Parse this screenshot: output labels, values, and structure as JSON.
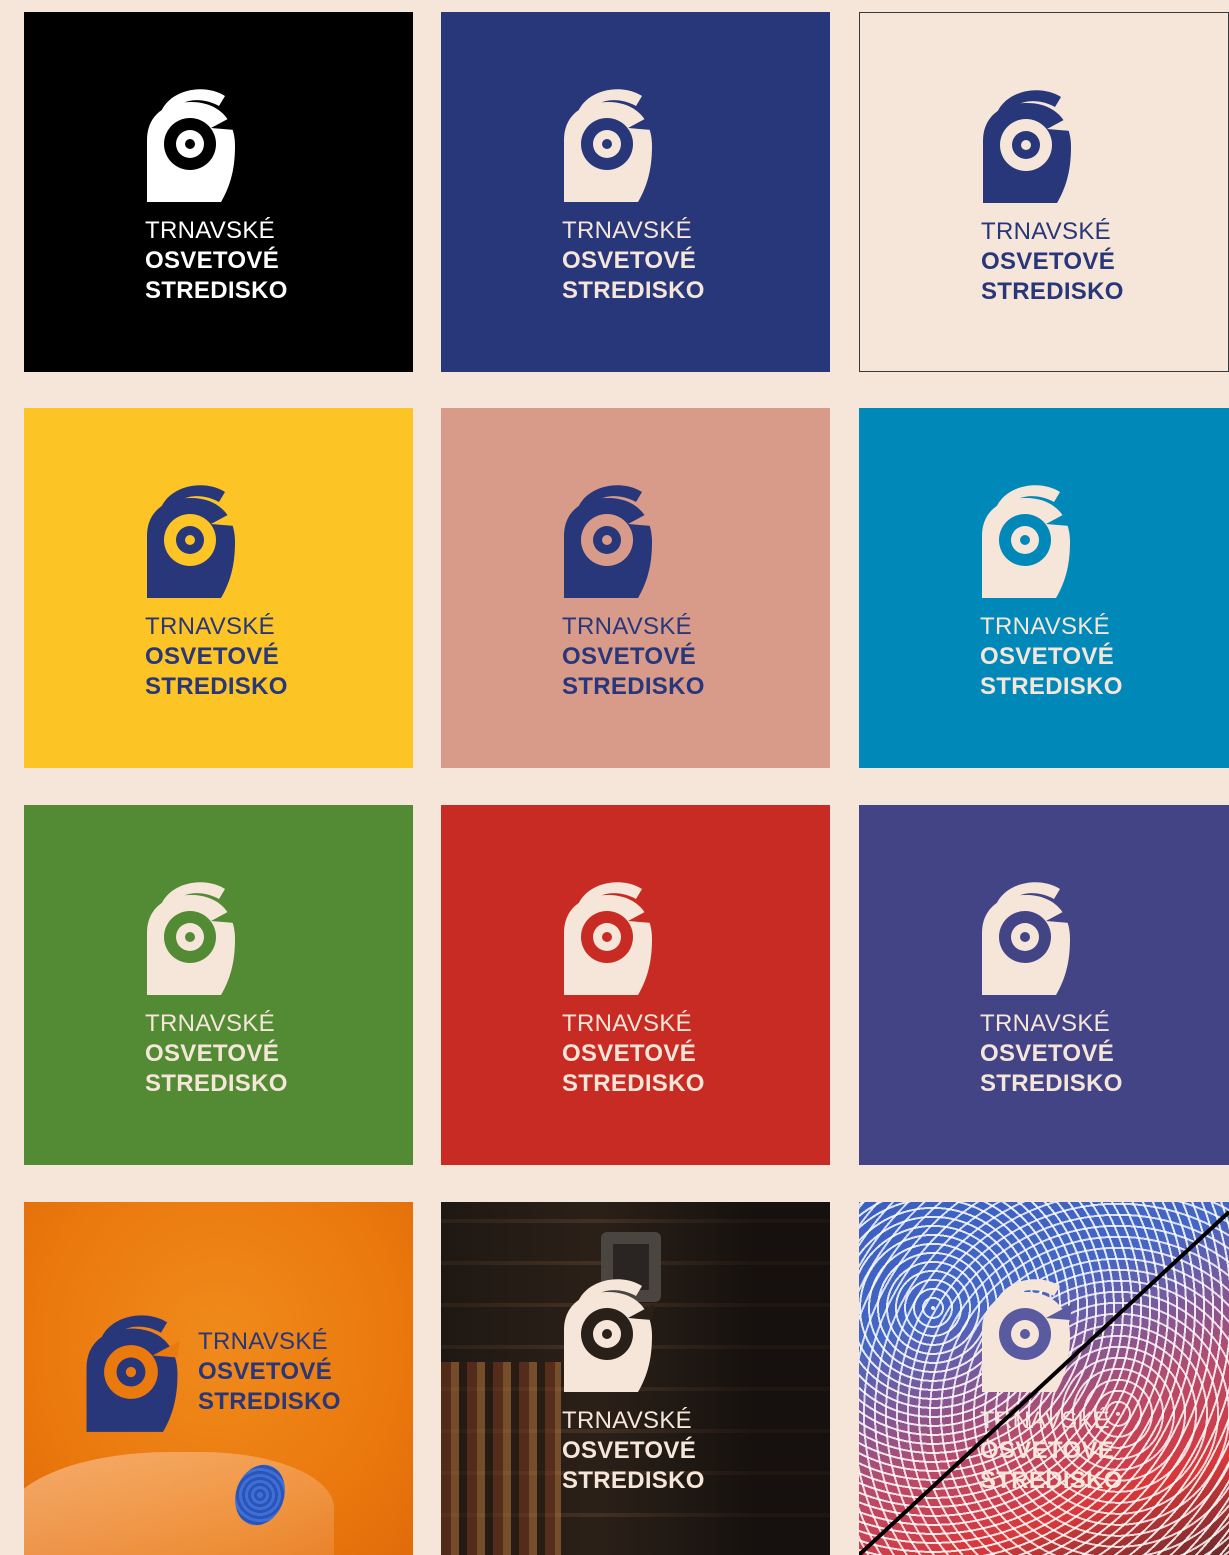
{
  "logo_text": {
    "line1": "TRNAVSKÉ",
    "line2": "OSVETOVÉ",
    "line3": "STREDISKO"
  },
  "tiles": [
    {
      "name": "black",
      "background": "#000000",
      "mark": "#ffffff",
      "text": "#ffffff"
    },
    {
      "name": "navy",
      "background": "#28367a",
      "mark": "#f5e6d9",
      "text": "#f5e6d9"
    },
    {
      "name": "cream",
      "background": "#f5e6d9",
      "mark": "#28367a",
      "text": "#28367a"
    },
    {
      "name": "yellow",
      "background": "#fcc425",
      "mark": "#28367a",
      "text": "#28367a"
    },
    {
      "name": "pink",
      "background": "#d89b8a",
      "mark": "#28367a",
      "text": "#28367a"
    },
    {
      "name": "teal",
      "background": "#0089b8",
      "mark": "#f5e6d9",
      "text": "#f5e6d9"
    },
    {
      "name": "green",
      "background": "#528b34",
      "mark": "#f5e6d9",
      "text": "#f5e6d9"
    },
    {
      "name": "red",
      "background": "#c82b24",
      "mark": "#f5e6d9",
      "text": "#f5e6d9"
    },
    {
      "name": "indigo",
      "background": "#434486",
      "mark": "#f5e6d9",
      "text": "#f5e6d9"
    }
  ],
  "photo_tiles": [
    {
      "name": "orange-photo",
      "mark": "#28367a",
      "text": "#28367a"
    },
    {
      "name": "room-photo",
      "mark": "#f5e6d9",
      "text": "#f5e6d9"
    },
    {
      "name": "pattern-photo",
      "mark": "#f5e6d9",
      "text": "#f5e6d9"
    }
  ]
}
